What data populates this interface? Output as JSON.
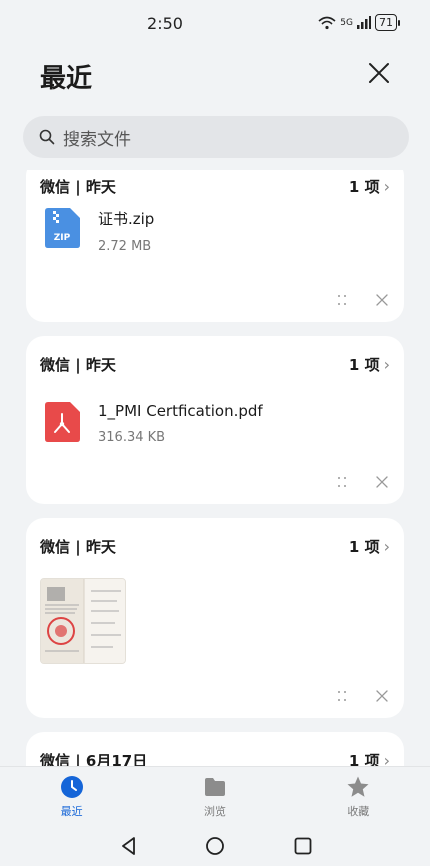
{
  "status_bar": {
    "time": "2:50",
    "network": "5G",
    "battery": "71"
  },
  "header": {
    "title": "最近"
  },
  "search": {
    "placeholder": "搜索文件"
  },
  "groups": [
    {
      "title": "微信 | 昨天",
      "count": "1 项",
      "file": {
        "name": "证书.zip",
        "size": "2.72 MB",
        "type_icon": "zip-icon",
        "badge": "ZIP"
      }
    },
    {
      "title": "微信 | 昨天",
      "count": "1 项",
      "file": {
        "name": "1_PMI Certfication.pdf",
        "size": "316.34 KB",
        "type_icon": "pdf-icon"
      }
    },
    {
      "title": "微信 | 昨天",
      "count": "1 项",
      "file": {
        "type_icon": "image-thumbnail"
      }
    },
    {
      "title": "微信 | 6月17日",
      "count": "1 项"
    }
  ],
  "bottom_nav": [
    {
      "label": "最近",
      "icon": "clock-icon",
      "active": true
    },
    {
      "label": "浏览",
      "icon": "folder-icon",
      "active": false
    },
    {
      "label": "收藏",
      "icon": "star-icon",
      "active": false
    }
  ],
  "colors": {
    "accent": "#1565d8",
    "zip": "#4a90e2",
    "pdf": "#e84a4a",
    "background": "#f1f3f5"
  }
}
